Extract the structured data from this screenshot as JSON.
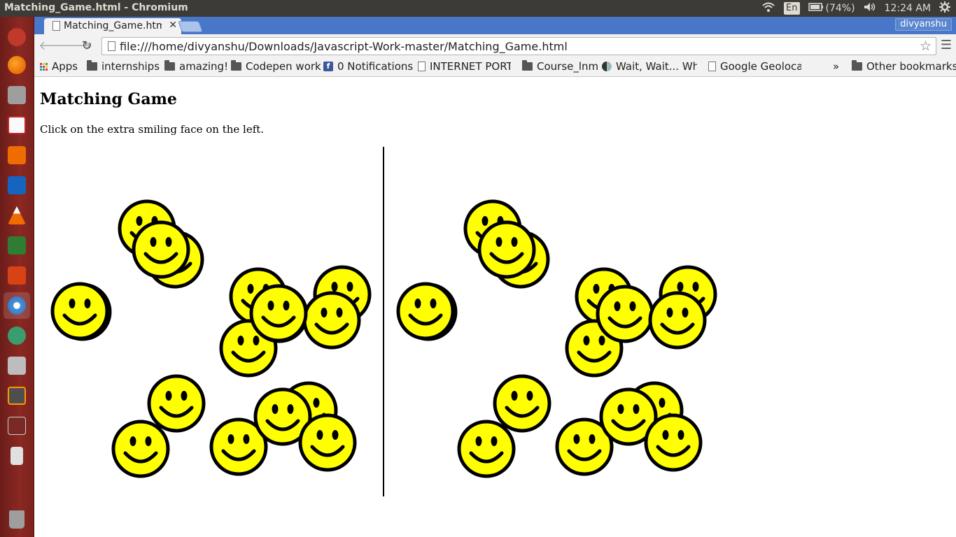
{
  "os": {
    "window_title": "Matching_Game.html - Chromium",
    "keyboard": "En",
    "battery": "(74%)",
    "clock": "12:24 AM"
  },
  "browser": {
    "tab_title": "Matching_Game.html",
    "profile": "divyanshu",
    "url": "file:///home/divyanshu/Downloads/Javascript-Work-master/Matching_Game.html",
    "bookmarks": [
      {
        "label": "Apps",
        "icon": "apps-grid-icon"
      },
      {
        "label": "internships",
        "icon": "folder-icon"
      },
      {
        "label": "amazing!",
        "icon": "folder-icon"
      },
      {
        "label": "Codepen work",
        "icon": "folder-icon"
      },
      {
        "label": "0 Notifications",
        "icon": "facebook-icon"
      },
      {
        "label": "INTERNET PORTA",
        "icon": "page-icon"
      },
      {
        "label": "Course_lnm",
        "icon": "folder-icon"
      },
      {
        "label": "Wait, Wait... Wha",
        "icon": "site-icon"
      },
      {
        "label": "Google Geolocati",
        "icon": "page-icon"
      }
    ],
    "bookmarks_overflow": "»",
    "other_bookmarks": "Other bookmarks"
  },
  "page": {
    "title": "Matching Game",
    "instructions": "Click on the extra smiling face on the left.",
    "face_color": "#ffff00",
    "left_face_count": 17,
    "right_face_count": 16
  }
}
